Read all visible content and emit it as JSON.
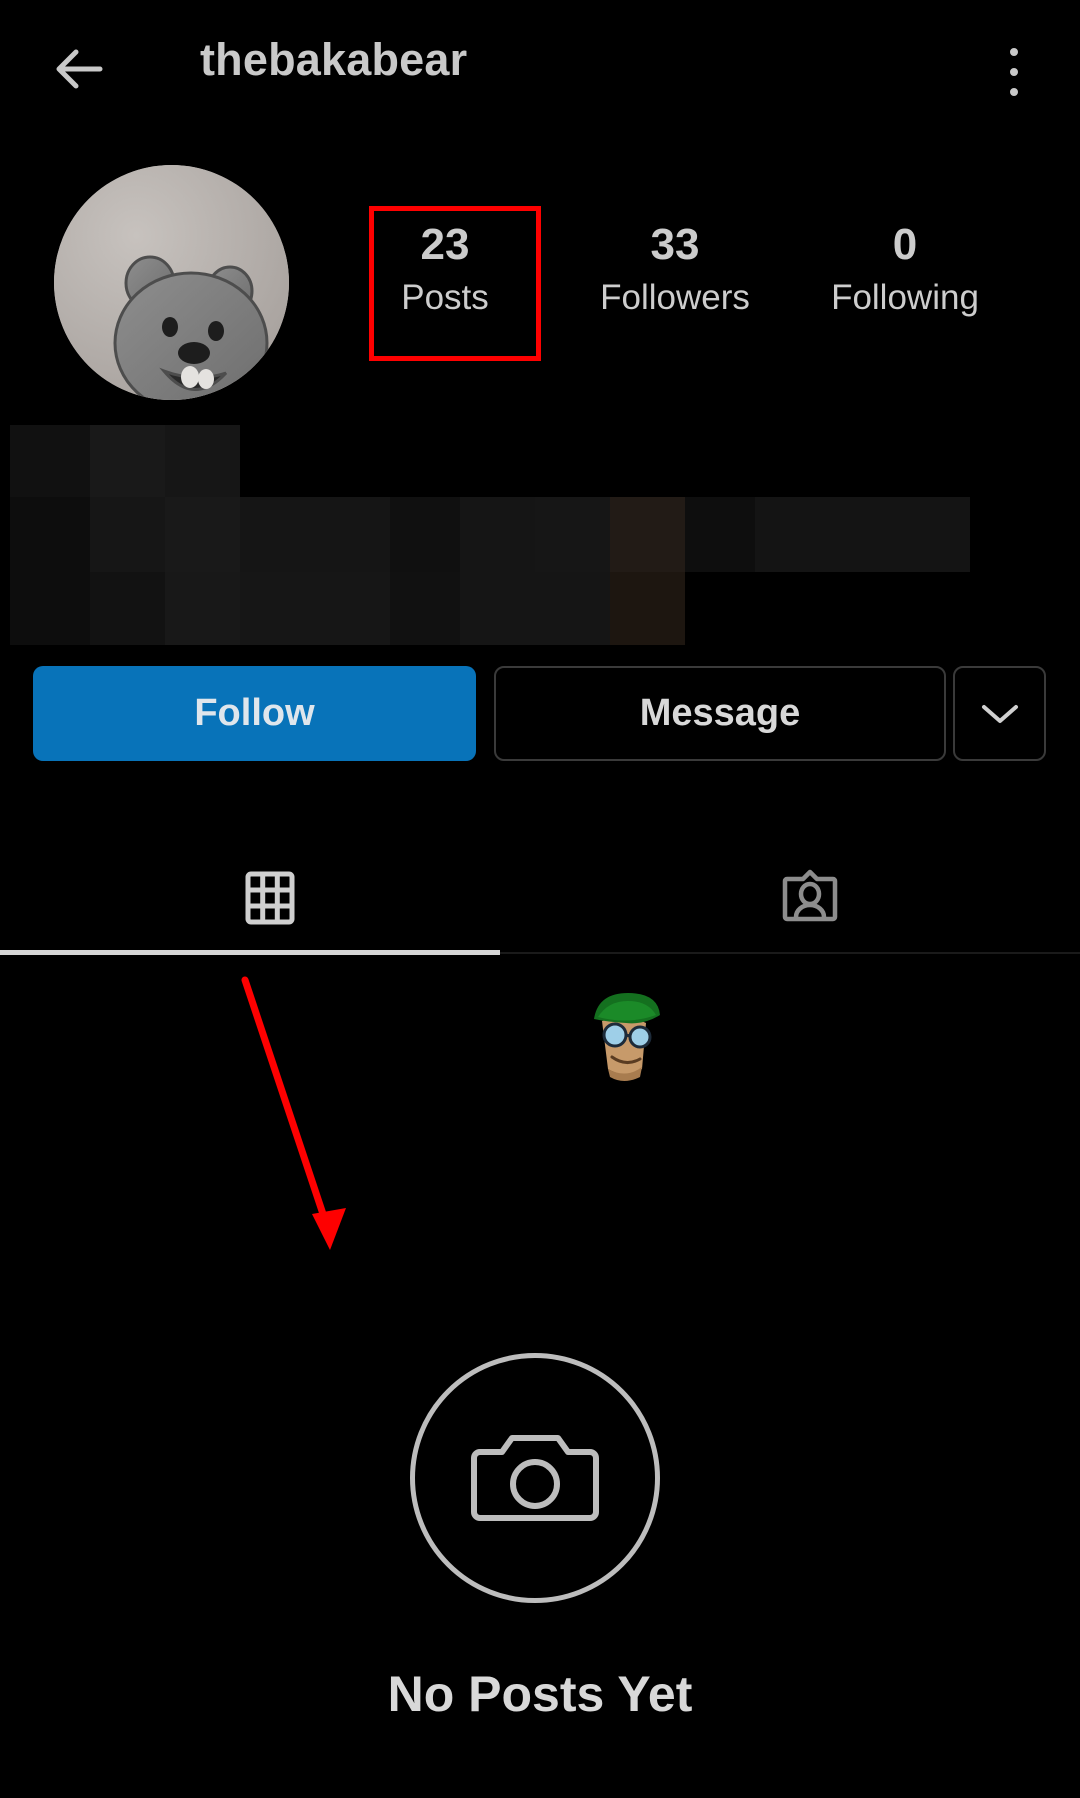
{
  "app": "instagram-profile",
  "header": {
    "back_icon": "back-arrow-icon",
    "title": "thebakabear",
    "menu_icon": "overflow-menu-icon"
  },
  "profile": {
    "avatar_alt": "grey-bear-avatar",
    "stats": [
      {
        "value": "23",
        "label": "Posts",
        "highlighted": true
      },
      {
        "value": "33",
        "label": "Followers",
        "highlighted": false
      },
      {
        "value": "0",
        "label": "Following",
        "highlighted": false
      }
    ],
    "bio_redacted": true
  },
  "actions": {
    "follow_label": "Follow",
    "message_label": "Message",
    "more_icon": "chevron-down-icon"
  },
  "tabs": [
    {
      "id": "grid",
      "icon": "grid-icon",
      "active": true
    },
    {
      "id": "tagged",
      "icon": "tagged-person-icon",
      "active": false
    }
  ],
  "empty_state": {
    "icon": "camera-icon",
    "title": "No Posts Yet"
  },
  "annotations": {
    "highlight_color": "#fe0000",
    "arrow_color": "#fe0000"
  },
  "colors": {
    "background": "#000000",
    "follow_button": "#0873b9",
    "text_primary": "#d8d8d8",
    "border": "#3a3a3a"
  }
}
